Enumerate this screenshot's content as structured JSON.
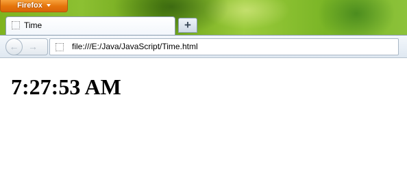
{
  "browser": {
    "menu_button_label": "Firefox",
    "new_tab_symbol": "+",
    "back_symbol": "←",
    "forward_symbol": "→"
  },
  "tabs": [
    {
      "title": "Time",
      "icon": "blank-page-icon"
    }
  ],
  "address_bar": {
    "url": "file:///E:/Java/JavaScript/Time.html",
    "icon": "blank-page-icon"
  },
  "page": {
    "heading": "7:27:53 AM"
  },
  "colors": {
    "firefox_button": "#e5740b",
    "desktop_green": "#7fb31f"
  }
}
